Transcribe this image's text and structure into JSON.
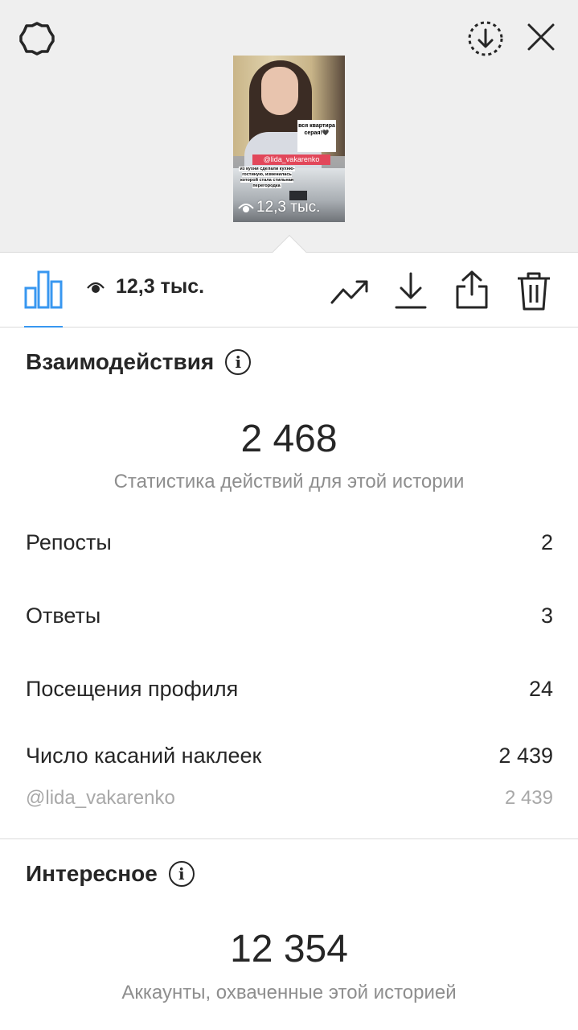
{
  "header": {
    "settings_icon": "gear-icon",
    "save_icon": "circle-download-icon",
    "close_icon": "close-icon"
  },
  "story": {
    "sticker_text": "вся квартира серая!🖤",
    "mention": "@lida_vakarenko",
    "caption": "из кухни сделали кухню-гостиную, изменилась которой стала стильная перегородка",
    "views_label": "12,3 тыс."
  },
  "toolbar": {
    "views_label": "12,3 тыс.",
    "accent_color": "#3897f0"
  },
  "interactions": {
    "title": "Взаимодействия",
    "total": "2 468",
    "subtitle": "Статистика действий для этой истории",
    "rows": [
      {
        "label": "Репосты",
        "value": "2"
      },
      {
        "label": "Ответы",
        "value": "3"
      },
      {
        "label": "Посещения профиля",
        "value": "24"
      },
      {
        "label": "Число касаний наклеек",
        "value": "2 439"
      }
    ],
    "sticker_row": {
      "label": "@lida_vakarenko",
      "value": "2 439"
    }
  },
  "discovery": {
    "title": "Интересное",
    "total": "12 354",
    "subtitle": "Аккаунты, охваченные этой историей"
  }
}
